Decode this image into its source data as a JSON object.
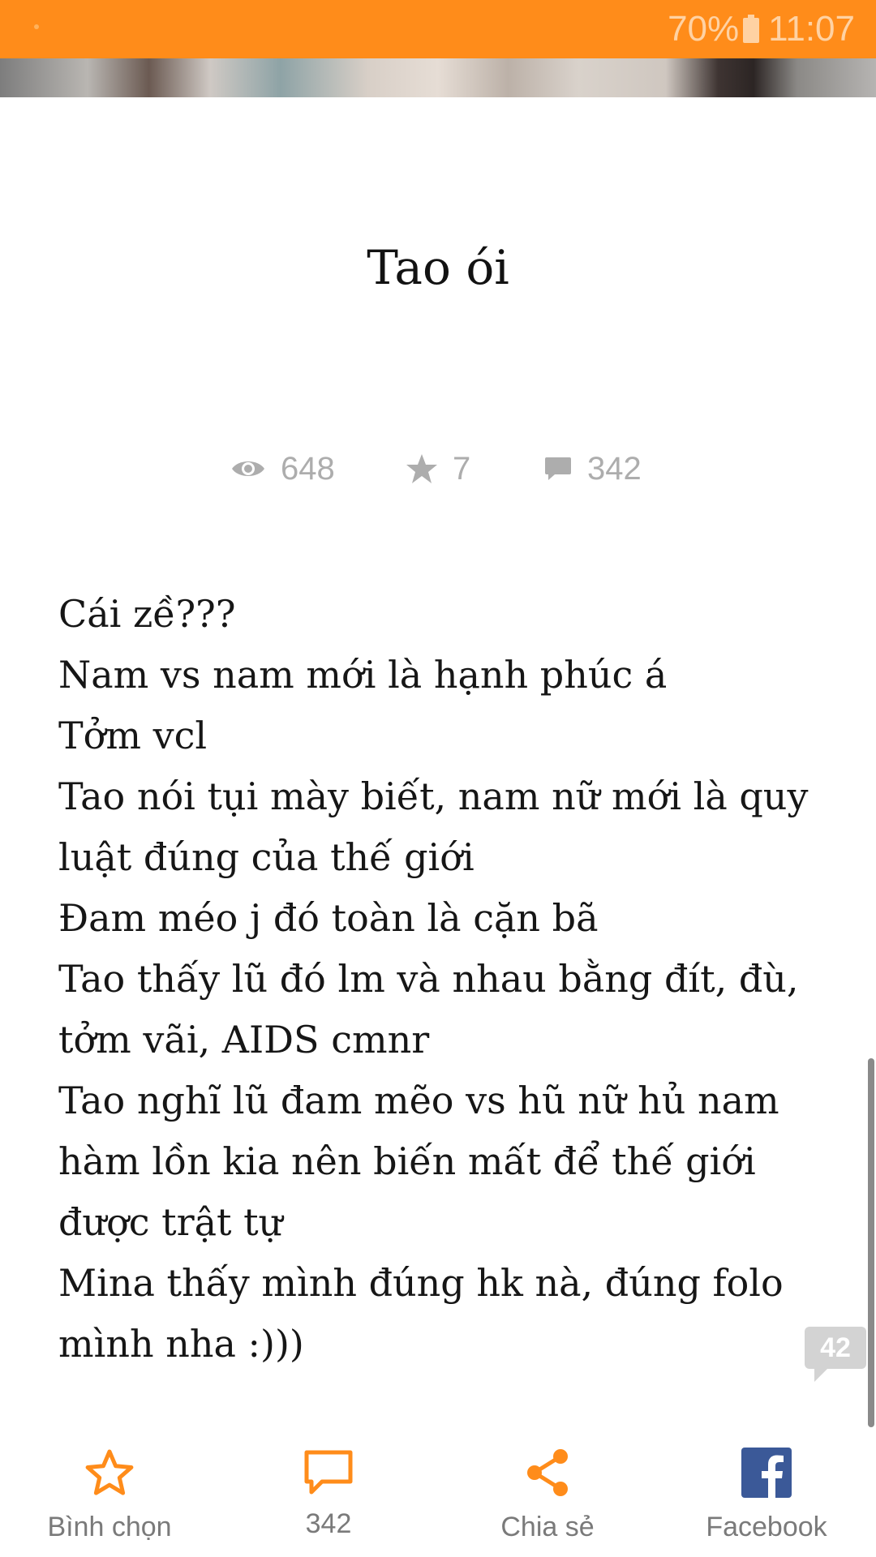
{
  "status_bar": {
    "battery_percent": "70%",
    "time": "11:07",
    "battery_icon": "battery-icon",
    "background_color": "#ff8c1a"
  },
  "story": {
    "title": "Tao ói",
    "stats": {
      "views": "648",
      "votes": "7",
      "comments": "342"
    },
    "lines": [
      "Cái zề???",
      "Nam vs nam mới là hạnh phúc á",
      "Tởm vcl",
      "Tao nói tụi mày biết, nam nữ mới là quy luật đúng của thế giới",
      "Đam méo j đó toàn là cặn bã",
      "Tao thấy lũ đó lm và nhau bằng đít, đù, tởm vãi, AIDS cmnr",
      "Tao nghĩ lũ đam mẽo vs hũ nữ hủ nam hàm lồn kia nên biến mất để thế giới được trật tự",
      "Mina thấy mình đúng hk nà, đúng folo mình nha :)))"
    ],
    "inline_comment_count": "42"
  },
  "actions": {
    "vote_label": "Bình chọn",
    "comments_label": "342",
    "share_label": "Chia sẻ",
    "facebook_label": "Facebook"
  },
  "colors": {
    "accent": "#ff8c1a",
    "facebook": "#3b5998",
    "muted_text": "#adadad"
  }
}
